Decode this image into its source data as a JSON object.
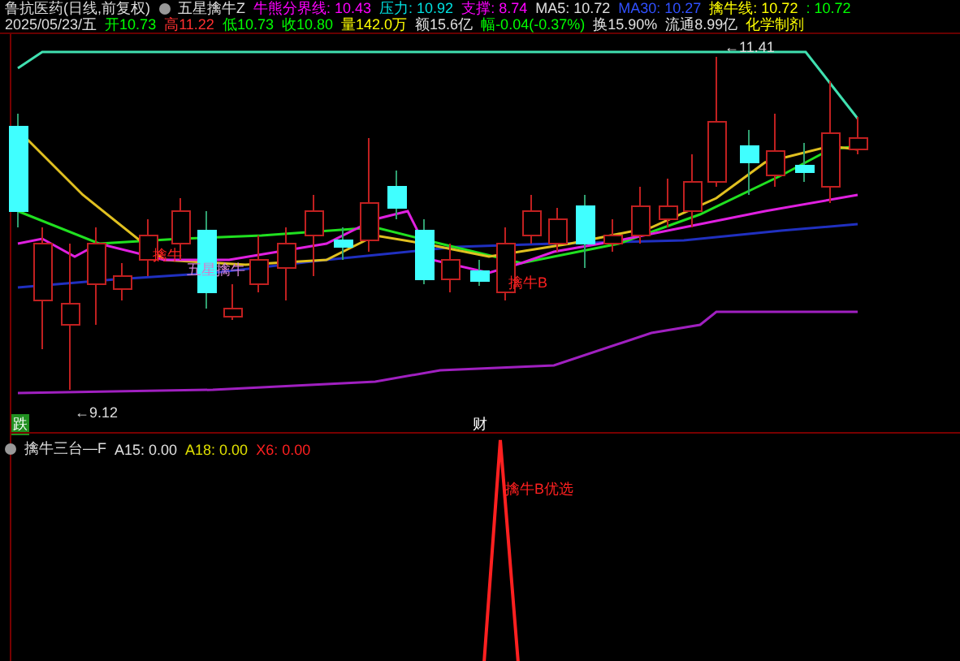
{
  "title_bar": {
    "stock": "鲁抗医药(日线,前复权)",
    "indicator": "五星擒牛Z",
    "values": [
      {
        "text": "牛熊分界线: 10.43",
        "color": "#ff00ff"
      },
      {
        "text": "压力: 10.92",
        "color": "#00e0e0"
      },
      {
        "text": "支撑: 8.74",
        "color": "#ff00ff"
      },
      {
        "text": "MA5: 10.72",
        "color": "#e0e0e0"
      },
      {
        "text": "MA30: 10.27",
        "color": "#3050ff"
      },
      {
        "text": "擒牛线: 10.72",
        "color": "#ffff00"
      },
      {
        "text": ": 10.72",
        "color": "#00ff00"
      }
    ]
  },
  "quote_bar": {
    "date": "2025/05/23/五",
    "items": [
      {
        "text": "开10.73",
        "color": "#00ff00"
      },
      {
        "text": "高11.22",
        "color": "#ff3030"
      },
      {
        "text": "低10.73",
        "color": "#00ff00"
      },
      {
        "text": "收10.80",
        "color": "#00ff00"
      },
      {
        "text": "量142.0万",
        "color": "#ffff00"
      },
      {
        "text": "额15.6亿",
        "color": "#e0e0e0"
      },
      {
        "text": "幅-0.04(-0.37%)",
        "color": "#00ff00"
      },
      {
        "text": "换15.90%",
        "color": "#e0e0e0"
      },
      {
        "text": "流通8.99亿",
        "color": "#e0e0e0"
      },
      {
        "text": "化学制剂",
        "color": "#ffff00"
      }
    ]
  },
  "main_chart": {
    "labels": [
      {
        "kind": "price",
        "text": "←11.41"
      },
      {
        "kind": "price",
        "text": "←9.12"
      },
      {
        "kind": "signal",
        "text": "擒牛"
      },
      {
        "kind": "tag",
        "text": "五星擒牛"
      },
      {
        "kind": "signal",
        "text": "擒牛B"
      }
    ],
    "markers": [
      {
        "text": "跌"
      },
      {
        "text": "财"
      }
    ]
  },
  "sub_chart": {
    "name": "擒牛三台—F",
    "values": [
      {
        "text": "A15: 0.00",
        "color": "#e0e0e0"
      },
      {
        "text": "A18: 0.00",
        "color": "#e0e000"
      },
      {
        "text": "X6: 0.00",
        "color": "#ff2020"
      }
    ],
    "signal_label": "擒牛B优选"
  }
}
